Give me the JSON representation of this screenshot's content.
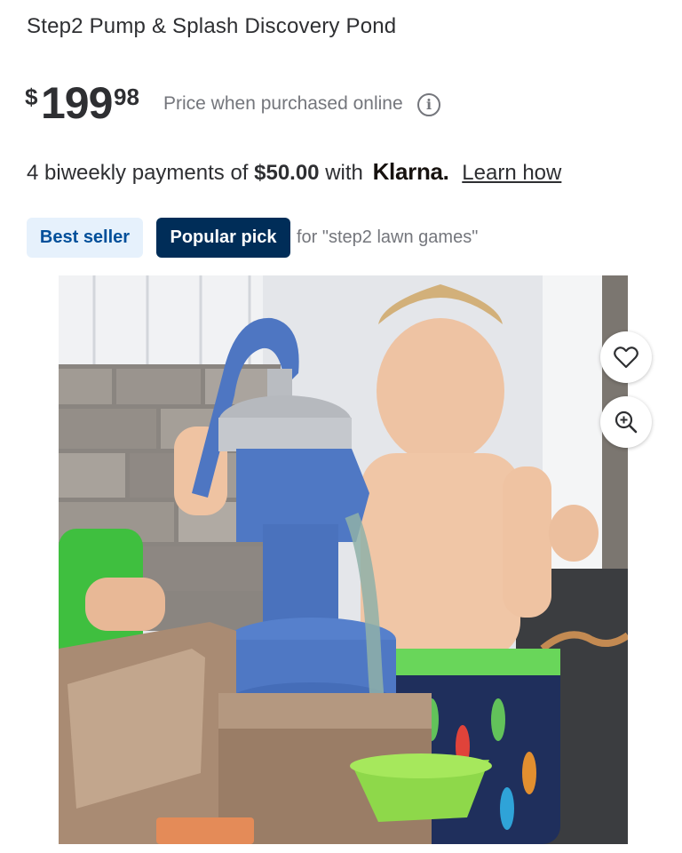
{
  "product": {
    "title": "Step2 Pump & Splash Discovery Pond"
  },
  "price": {
    "currency": "$",
    "dollars": "199",
    "cents": "98",
    "note": "Price when purchased online",
    "info_icon": "info-icon"
  },
  "klarna": {
    "prefix": "4 biweekly payments of ",
    "amount": "$50.00",
    "middle": " with",
    "brand": "Klarna.",
    "link": "Learn how"
  },
  "badges": {
    "best_seller": "Best seller",
    "popular_pick": "Popular pick",
    "for_text": "for \"step2 lawn games\""
  },
  "image_actions": {
    "favorite_icon": "heart-icon",
    "zoom_icon": "zoom-in-icon"
  },
  "colors": {
    "best_seller_bg": "#e6f1fc",
    "best_seller_text": "#004f9a",
    "popular_bg": "#002d58",
    "popular_text": "#ffffff"
  }
}
